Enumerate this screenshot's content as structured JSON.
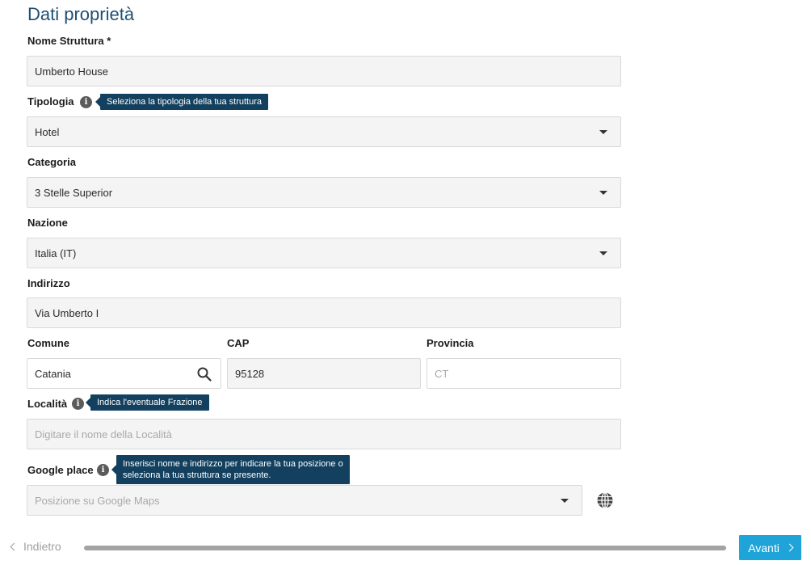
{
  "page": {
    "title": "Dati proprietà"
  },
  "form": {
    "nome_struttura": {
      "label": "Nome Struttura *",
      "value": "Umberto House"
    },
    "tipologia": {
      "label": "Tipologia",
      "value": "Hotel",
      "tooltip": "Seleziona la tipologia della tua struttura"
    },
    "categoria": {
      "label": "Categoria",
      "value": "3 Stelle Superior"
    },
    "nazione": {
      "label": "Nazione",
      "value": "Italia (IT)"
    },
    "indirizzo": {
      "label": "Indirizzo",
      "value": "Via Umberto I"
    },
    "comune": {
      "label": "Comune",
      "value": "Catania"
    },
    "cap": {
      "label": "CAP",
      "value": "95128"
    },
    "provincia": {
      "label": "Provincia",
      "placeholder": "CT"
    },
    "localita": {
      "label": "Località",
      "placeholder": "Digitare il nome della Località",
      "tooltip": "Indica l'eventuale Frazione"
    },
    "google_place": {
      "label": "Google place",
      "placeholder": "Posizione su Google Maps",
      "tooltip_line1": "Inserisci nome e indirizzo per indicare la tua posizione o",
      "tooltip_line2": "seleziona la tua struttura se presente."
    }
  },
  "navigation": {
    "back_label": "Indietro",
    "next_label": "Avanti"
  },
  "icons": {
    "info": "info-icon",
    "search": "search-icon",
    "globe": "globe-icon",
    "dropdown": "chevron-down-icon"
  },
  "colors": {
    "title": "#1f4f73",
    "tooltip_bg": "#12405e",
    "primary_button": "#1fa4d9"
  }
}
